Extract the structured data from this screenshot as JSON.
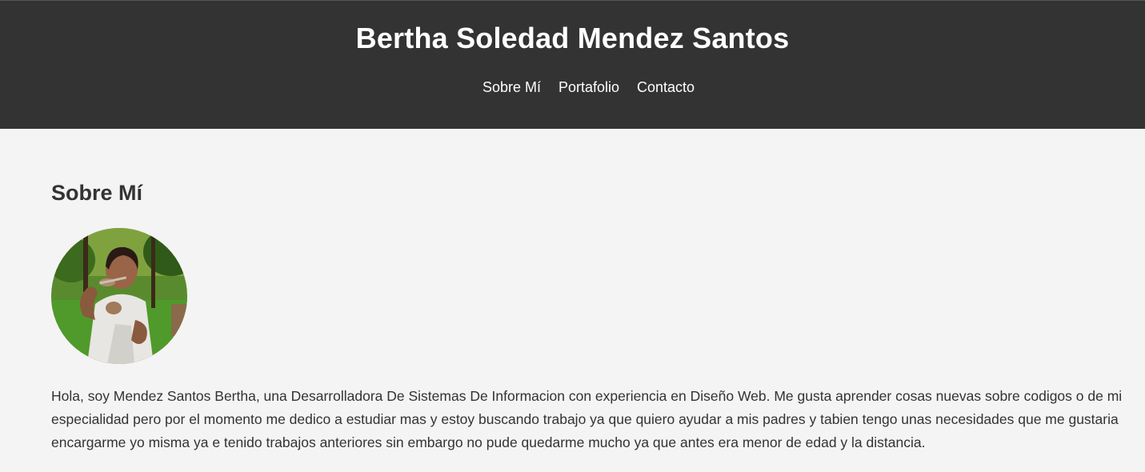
{
  "header": {
    "title": "Bertha Soledad Mendez Santos",
    "background": "#333333",
    "nav": [
      {
        "label": "Sobre Mí"
      },
      {
        "label": "Portafolio"
      },
      {
        "label": "Contacto"
      }
    ]
  },
  "about": {
    "heading": "Sobre Mí",
    "photo_alt": "Bertha Soledad Mendez Santos",
    "bio": "Hola, soy Mendez Santos Bertha, una Desarrolladora De Sistemas De Informacion con experiencia en Diseño Web. Me gusta aprender cosas nuevas sobre codigos o de mi especialidad pero por el momento me dedico a estudiar mas y estoy buscando trabajo ya que quiero ayudar a mis padres y tabien tengo unas necesidades que me gustaria encargarme yo misma ya e tenido trabajos anteriores sin embargo no pude quedarme mucho ya que antes era menor de edad y la distancia."
  },
  "colors": {
    "header_bg": "#333333",
    "page_bg": "#f4f4f4",
    "text": "#333333"
  }
}
